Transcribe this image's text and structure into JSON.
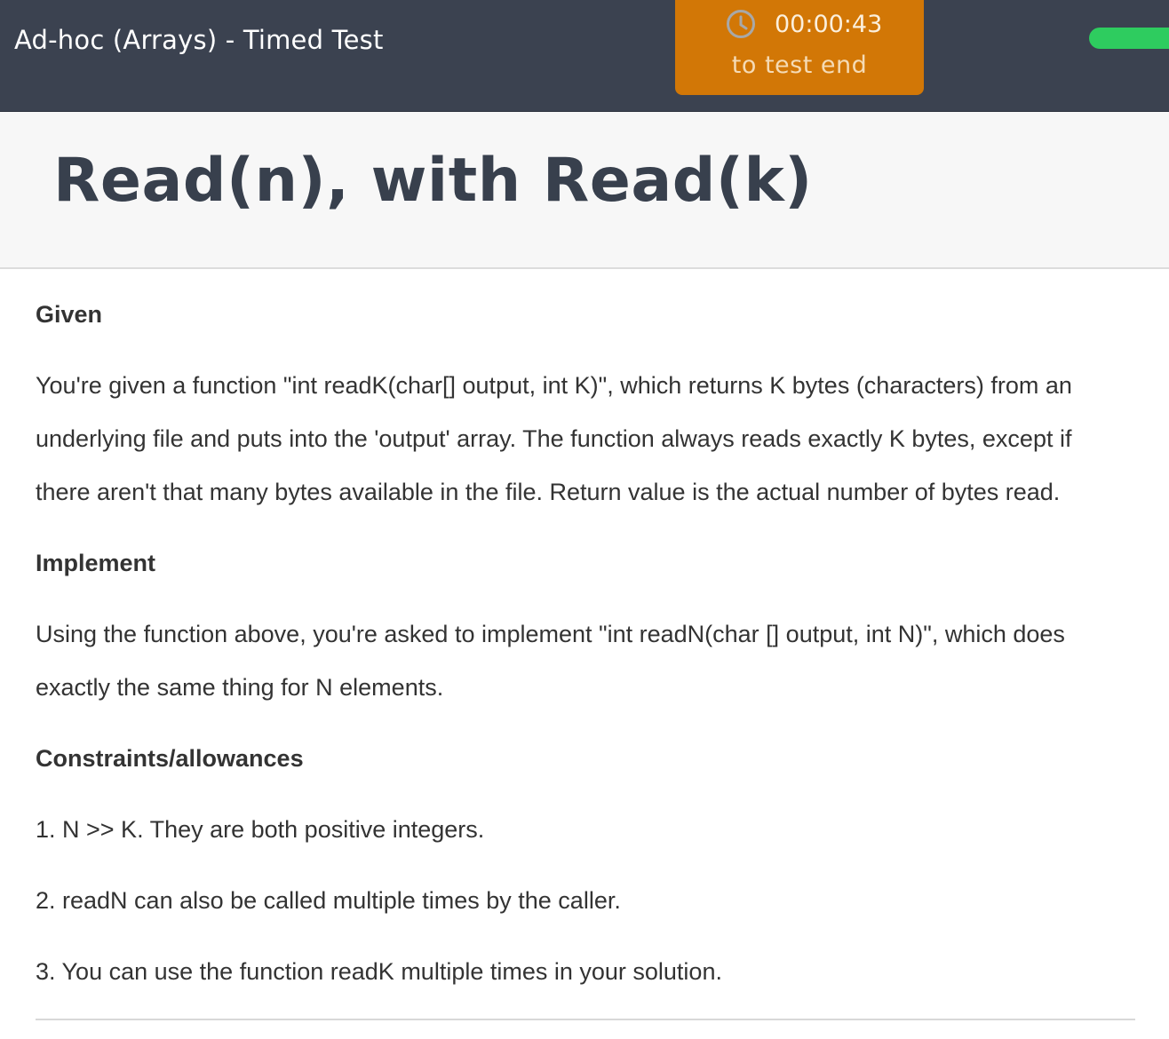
{
  "header": {
    "test_title": "Ad-hoc (Arrays) - Timed Test",
    "timer": {
      "time": "00:00:43",
      "label": "to test end",
      "icon": "clock-icon"
    },
    "progress_color": "#2ecc5f"
  },
  "problem": {
    "title": "Read(n), with Read(k)"
  },
  "sections": {
    "given": {
      "heading": "Given",
      "lines": [
        "You're given a function \"int readK(char[] output, int K)\", which returns K bytes (characters) from an",
        "underlying file and puts into the 'output' array. The function always reads exactly K bytes, except if",
        "there aren't that many bytes available in the file. Return value is the actual number of bytes read."
      ]
    },
    "implement": {
      "heading": "Implement",
      "lines": [
        "Using the function above, you're asked to implement  \"int readN(char [] output, int N)\", which does",
        "exactly the same thing for N elements."
      ]
    },
    "constraints": {
      "heading": "Constraints/allowances",
      "items": [
        "1. N >> K. They are both positive integers.",
        "2. readN can also be called multiple times by the caller.",
        "3. You can use the function readK multiple times in your solution."
      ]
    }
  },
  "colors": {
    "topbar": "#3b4250",
    "timer": "#d27706",
    "title_text": "#38404d"
  }
}
